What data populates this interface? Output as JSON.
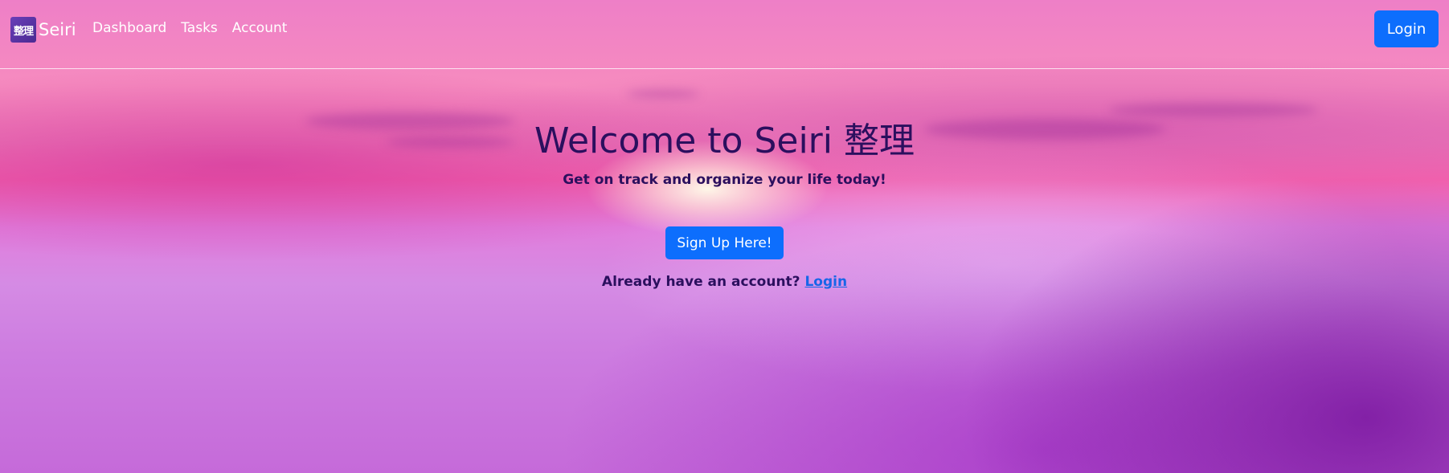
{
  "navbar": {
    "brand_logo_text": "整理",
    "brand_name": "Seiri",
    "links": [
      {
        "label": "Dashboard"
      },
      {
        "label": "Tasks"
      },
      {
        "label": "Account"
      }
    ],
    "login_label": "Login"
  },
  "hero": {
    "title": "Welcome to Seiri 整理",
    "subtitle": "Get on track and organize your life today!",
    "signup_label": "Sign Up Here!",
    "already_text": "Already have an account?",
    "login_link": "Login"
  },
  "colors": {
    "primary_button": "#0d6efd",
    "heading_text": "#2b0f5e",
    "link": "#1766e8"
  }
}
